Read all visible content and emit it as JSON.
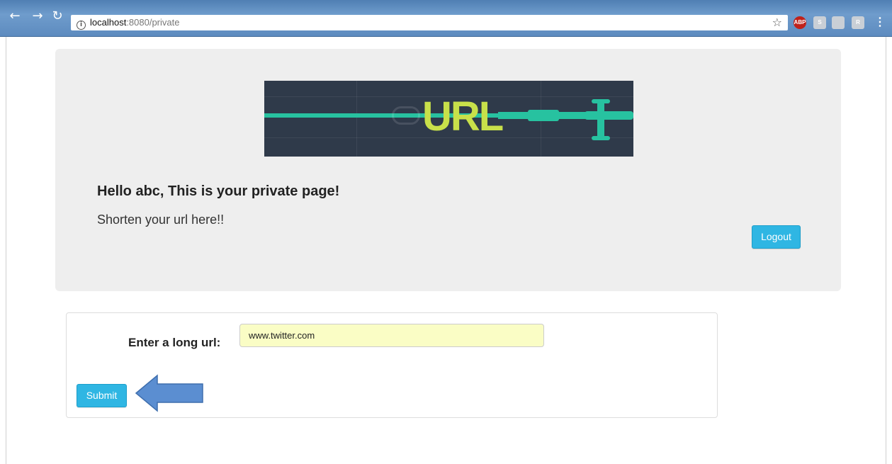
{
  "browser": {
    "back_icon": "arrow-left-icon",
    "forward_icon": "arrow-right-icon",
    "reload_icon": "reload-icon",
    "url_host": "localhost",
    "url_rest": ":8080/private",
    "bookmark_icon": "star-icon",
    "extensions": [
      "ABP",
      "S",
      "",
      "R"
    ],
    "menu_icon": "menu-dots-icon"
  },
  "jumbotron": {
    "banner_text": "URL",
    "greeting": "Hello abc, This is your private page!",
    "subtext": "Shorten your url here!!",
    "logout_label": "Logout"
  },
  "form": {
    "label": "Enter a long url:",
    "url_value": "www.twitter.com",
    "submit_label": "Submit"
  },
  "annotation": {
    "arrow_color": "#5b8ed1",
    "arrow_icon": "arrow-left-pointer"
  }
}
